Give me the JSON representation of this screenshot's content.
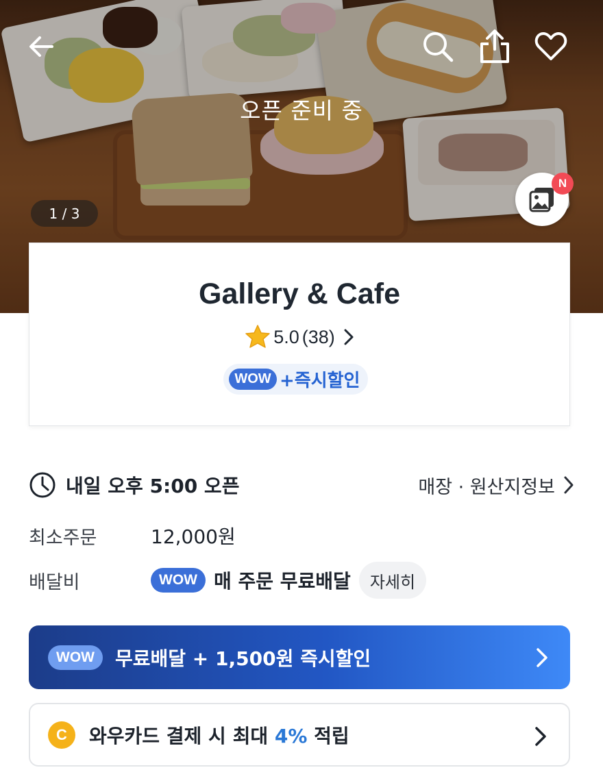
{
  "header": {
    "open_status": "오픈 준비 중",
    "photo_counter": "1 / 3",
    "new_badge": "N"
  },
  "store": {
    "name": "Gallery & Cafe",
    "rating": "5.0",
    "review_count": "(38)",
    "wow_label": "WOW",
    "discount_label": "+즉시할인"
  },
  "details": {
    "open_time": "내일 오후 5:00 오픈",
    "store_info_link": "매장 · 원산지정보",
    "min_order_label": "최소주문",
    "min_order_value": "12,000원",
    "delivery_fee_label": "배달비",
    "wow_label": "WOW",
    "delivery_fee_value": "매 주문 무료배달",
    "detail_button": "자세히"
  },
  "promo": {
    "wow_label": "WOW",
    "text": "무료배달 + 1,500원 즉시할인"
  },
  "card_promo": {
    "coin_letter": "C",
    "text_before": "와우카드 결제 시 최대 ",
    "highlight": "4%",
    "text_after": " 적립"
  },
  "colors": {
    "wow_blue": "#3b6fd8",
    "promo_gradient_start": "#1c3c89",
    "promo_gradient_end": "#3e89f7",
    "highlight_blue": "#2a78d6",
    "coin_yellow": "#f5b21a",
    "new_badge_red": "#f24a55"
  },
  "icons": [
    "back-arrow-icon",
    "search-icon",
    "share-icon",
    "heart-icon",
    "photo-gallery-icon",
    "star-icon",
    "clock-icon",
    "chevron-right-icon",
    "coin-icon"
  ]
}
